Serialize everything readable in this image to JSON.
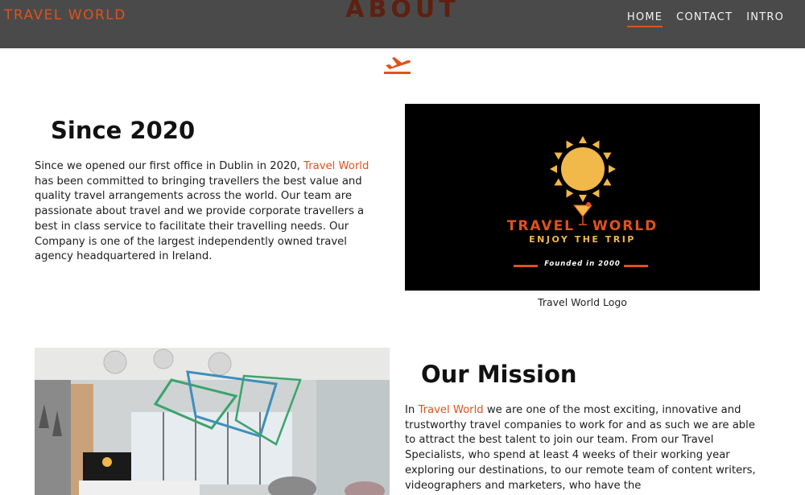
{
  "header": {
    "brand": "TRAVEL WORLD",
    "title": "ABOUT",
    "nav": [
      {
        "label": "HOME",
        "active": true
      },
      {
        "label": "CONTACT",
        "active": false
      },
      {
        "label": "INTRO",
        "active": false
      }
    ]
  },
  "divider_icon": "airplane-takeoff-icon",
  "since": {
    "heading": "Since 2020",
    "text_before": "Since we opened our first office in Dublin in 2020, ",
    "highlight": "Travel World",
    "text_after": " has been committed to bringing travellers the best value and quality travel arrangements across the world. Our team are passionate about travel and we provide corporate travellers a best in class service to facilitate their travelling needs. Our Company is one of the largest independently owned travel agency headquartered in Ireland."
  },
  "logo": {
    "wordmark_left": "TRAVEL",
    "wordmark_right": "WORLD",
    "tagline": "ENJOY THE TRIP",
    "founded": "Founded in 2000",
    "caption": "Travel World Logo"
  },
  "mission": {
    "heading": "Our Mission",
    "text_before": "In ",
    "highlight": "Travel World",
    "text_after": " we are one of the most exciting, innovative and trustworthy travel companies to work for and as such we are able to attract the best talent to join our team. From our Travel Specialists, who spend at least 4 weeks of their working year exploring our destinations, to our remote team of content writers, videographers and marketers, who have the"
  },
  "colors": {
    "accent": "#e0521b",
    "header_bg": "#4a4a4a",
    "title": "#5e2010",
    "sun": "#f1b84a"
  }
}
